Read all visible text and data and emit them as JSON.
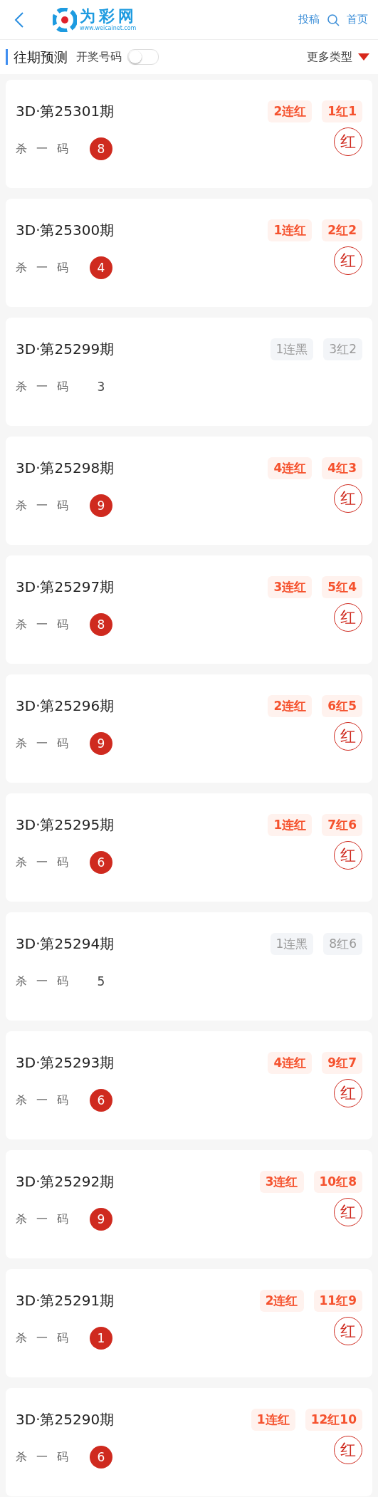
{
  "header": {
    "logo_title": "为彩网",
    "logo_url": "www.weicainet.com",
    "links": [
      "投稿",
      "首页"
    ]
  },
  "toolbar": {
    "title": "往期预测",
    "toggle_label": "开奖号码",
    "toggle_on": false,
    "more": "更多类型"
  },
  "cards": [
    {
      "issue": "3D·第25301期",
      "streak": "2连红",
      "tally": "1红1",
      "label": "杀 一 码",
      "number": "8",
      "hit": true,
      "result": "红"
    },
    {
      "issue": "3D·第25300期",
      "streak": "1连红",
      "tally": "2红2",
      "label": "杀 一 码",
      "number": "4",
      "hit": true,
      "result": "红"
    },
    {
      "issue": "3D·第25299期",
      "streak": "1连黑",
      "tally": "3红2",
      "label": "杀 一 码",
      "number": "3",
      "hit": false
    },
    {
      "issue": "3D·第25298期",
      "streak": "4连红",
      "tally": "4红3",
      "label": "杀 一 码",
      "number": "9",
      "hit": true,
      "result": "红"
    },
    {
      "issue": "3D·第25297期",
      "streak": "3连红",
      "tally": "5红4",
      "label": "杀 一 码",
      "number": "8",
      "hit": true,
      "result": "红"
    },
    {
      "issue": "3D·第25296期",
      "streak": "2连红",
      "tally": "6红5",
      "label": "杀 一 码",
      "number": "9",
      "hit": true,
      "result": "红"
    },
    {
      "issue": "3D·第25295期",
      "streak": "1连红",
      "tally": "7红6",
      "label": "杀 一 码",
      "number": "6",
      "hit": true,
      "result": "红"
    },
    {
      "issue": "3D·第25294期",
      "streak": "1连黑",
      "tally": "8红6",
      "label": "杀 一 码",
      "number": "5",
      "hit": false
    },
    {
      "issue": "3D·第25293期",
      "streak": "4连红",
      "tally": "9红7",
      "label": "杀 一 码",
      "number": "6",
      "hit": true,
      "result": "红"
    },
    {
      "issue": "3D·第25292期",
      "streak": "3连红",
      "tally": "10红8",
      "label": "杀 一 码",
      "number": "9",
      "hit": true,
      "result": "红"
    },
    {
      "issue": "3D·第25291期",
      "streak": "2连红",
      "tally": "11红9",
      "label": "杀 一 码",
      "number": "1",
      "hit": true,
      "result": "红"
    },
    {
      "issue": "3D·第25290期",
      "streak": "1连红",
      "tally": "12红10",
      "label": "杀 一 码",
      "number": "6",
      "hit": true,
      "result": "红"
    }
  ]
}
